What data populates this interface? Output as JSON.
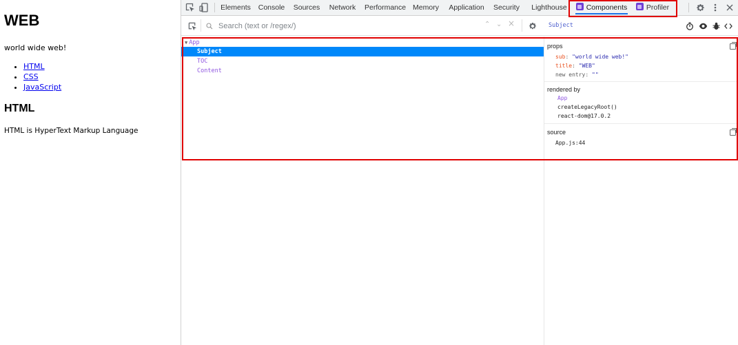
{
  "webpage": {
    "title": "WEB",
    "subtitle": "world wide web!",
    "links": [
      "HTML",
      "CSS",
      "JavaScript"
    ],
    "section_heading": "HTML",
    "section_text": "HTML is HyperText Markup Language"
  },
  "devtools": {
    "tabs": [
      "Elements",
      "Console",
      "Sources",
      "Network",
      "Performance",
      "Memory",
      "Application",
      "Security",
      "Lighthouse"
    ],
    "ext_tabs": {
      "components": "Components",
      "profiler": "Profiler"
    },
    "active_tab": "Components",
    "search": {
      "placeholder": "Search (text or /regex/)"
    },
    "selected_component": "Subject",
    "tree": [
      {
        "label": "App",
        "depth": 0,
        "expanded": true
      },
      {
        "label": "Subject",
        "depth": 1,
        "selected": true
      },
      {
        "label": "TOC",
        "depth": 1
      },
      {
        "label": "Content",
        "depth": 1
      }
    ],
    "props": {
      "title": "props",
      "items": [
        {
          "key": "sub",
          "value": "\"world wide web!\""
        },
        {
          "key": "title",
          "value": "\"WEB\""
        },
        {
          "key": "new entry",
          "value": "\"\""
        }
      ]
    },
    "rendered_by": {
      "title": "rendered by",
      "owners": [
        "App",
        "createLegacyRoot()",
        "react-dom@17.0.2"
      ]
    },
    "source": {
      "title": "source",
      "location": "App.js:44"
    },
    "colors": {
      "highlight_box": "#e00000",
      "selected_row": "#0088fa",
      "component_name": "#8f56e0",
      "prop_key": "#e8501f",
      "string_value": "#2c2cb0"
    }
  }
}
